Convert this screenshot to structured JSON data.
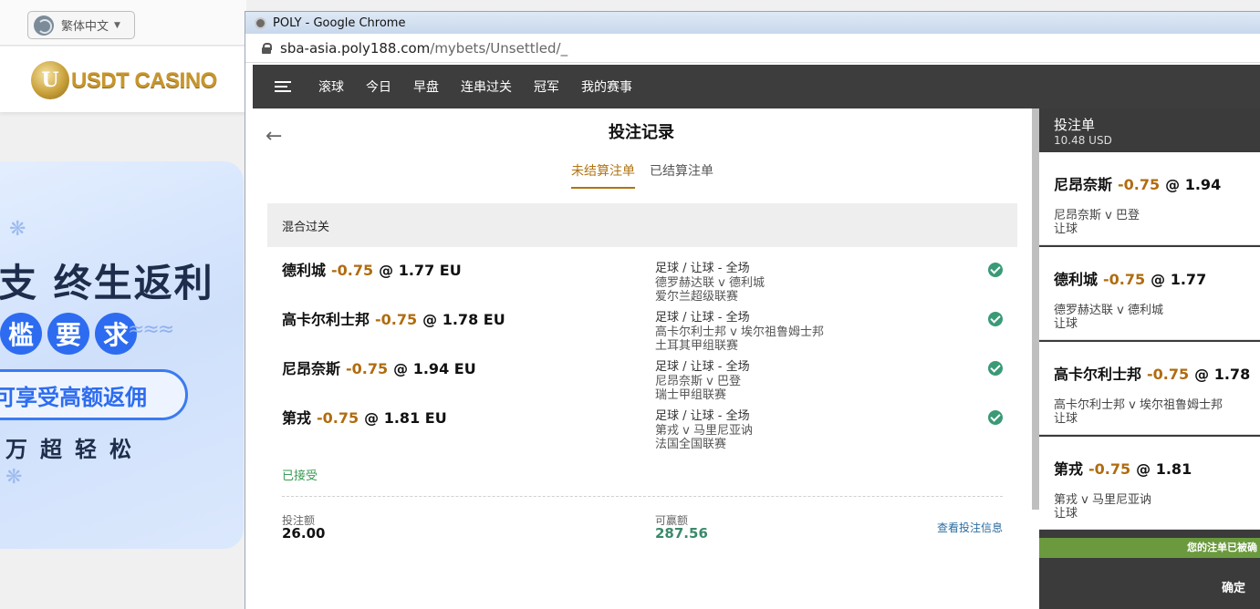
{
  "site": {
    "language_label": "繁体中文",
    "logo_text": "USDT CASINO",
    "logo_mark": "U",
    "banner": {
      "line1": "支 终生返利",
      "pill_chars": [
        "槛",
        "要",
        "求"
      ],
      "oval_text": "可享受高额返佣",
      "line4": "万超轻松"
    }
  },
  "browser": {
    "window_title": "POLY - Google Chrome",
    "url_host": "sba-asia.poly188.com",
    "url_path": "/mybets/Unsettled/_"
  },
  "nav": {
    "items": [
      "滚球",
      "今日",
      "早盘",
      "连串过关",
      "冠军",
      "我的赛事"
    ]
  },
  "page": {
    "title": "投注记录",
    "tabs": {
      "unsettled": "未结算注单",
      "settled": "已结算注单"
    },
    "group_title": "混合过关",
    "legs": [
      {
        "team": "德利城",
        "handicap": "-0.75",
        "at": "@",
        "odds": "1.77 EU",
        "market": "足球 / 让球 - 全场",
        "match": "德罗赫达联 v 德利城",
        "league": "爱尔兰超级联赛"
      },
      {
        "team": "高卡尔利士邦",
        "handicap": "-0.75",
        "at": "@",
        "odds": "1.78 EU",
        "market": "足球 / 让球 - 全场",
        "match": "高卡尔利士邦 v 埃尔祖鲁姆士邦",
        "league": "土耳其甲组联赛"
      },
      {
        "team": "尼昂奈斯",
        "handicap": "-0.75",
        "at": "@",
        "odds": "1.94 EU",
        "market": "足球 / 让球 - 全场",
        "match": "尼昂奈斯 v 巴登",
        "league": "瑞士甲组联赛"
      },
      {
        "team": "第戎",
        "handicap": "-0.75",
        "at": "@",
        "odds": "1.81 EU",
        "market": "足球 / 让球 - 全场",
        "match": "第戎 v 马里尼亚讷",
        "league": "法国全国联赛"
      }
    ],
    "status": "已接受",
    "stake_label": "投注额",
    "stake_value": "26.00",
    "win_label": "可赢额",
    "win_value": "287.56",
    "view_info": "查看投注信息"
  },
  "slip": {
    "title": "投注单",
    "balance": "10.48 USD",
    "cards": [
      {
        "team": "尼昂奈斯",
        "handicap": "-0.75",
        "at": "@",
        "odds": "1.94",
        "match": "尼昂奈斯 v 巴登",
        "type": "让球"
      },
      {
        "team": "德利城",
        "handicap": "-0.75",
        "at": "@",
        "odds": "1.77",
        "match": "德罗赫达联 v 德利城",
        "type": "让球"
      },
      {
        "team": "高卡尔利士邦",
        "handicap": "-0.75",
        "at": "@",
        "odds": "1.78",
        "match": "高卡尔利士邦 v 埃尔祖鲁姆士邦",
        "type": "让球"
      },
      {
        "team": "第戎",
        "handicap": "-0.75",
        "at": "@",
        "odds": "1.81",
        "match": "第戎 v 马里尼亚讷",
        "type": "让球"
      }
    ],
    "notice": "您的注单已被确",
    "confirm": "确定"
  },
  "colors": {
    "handicap": "#b06c10",
    "accent_tab": "#b07414",
    "win_value": "#3a8a6a",
    "accepted": "#3a9a54",
    "nav_bg": "#3d3d3d"
  }
}
